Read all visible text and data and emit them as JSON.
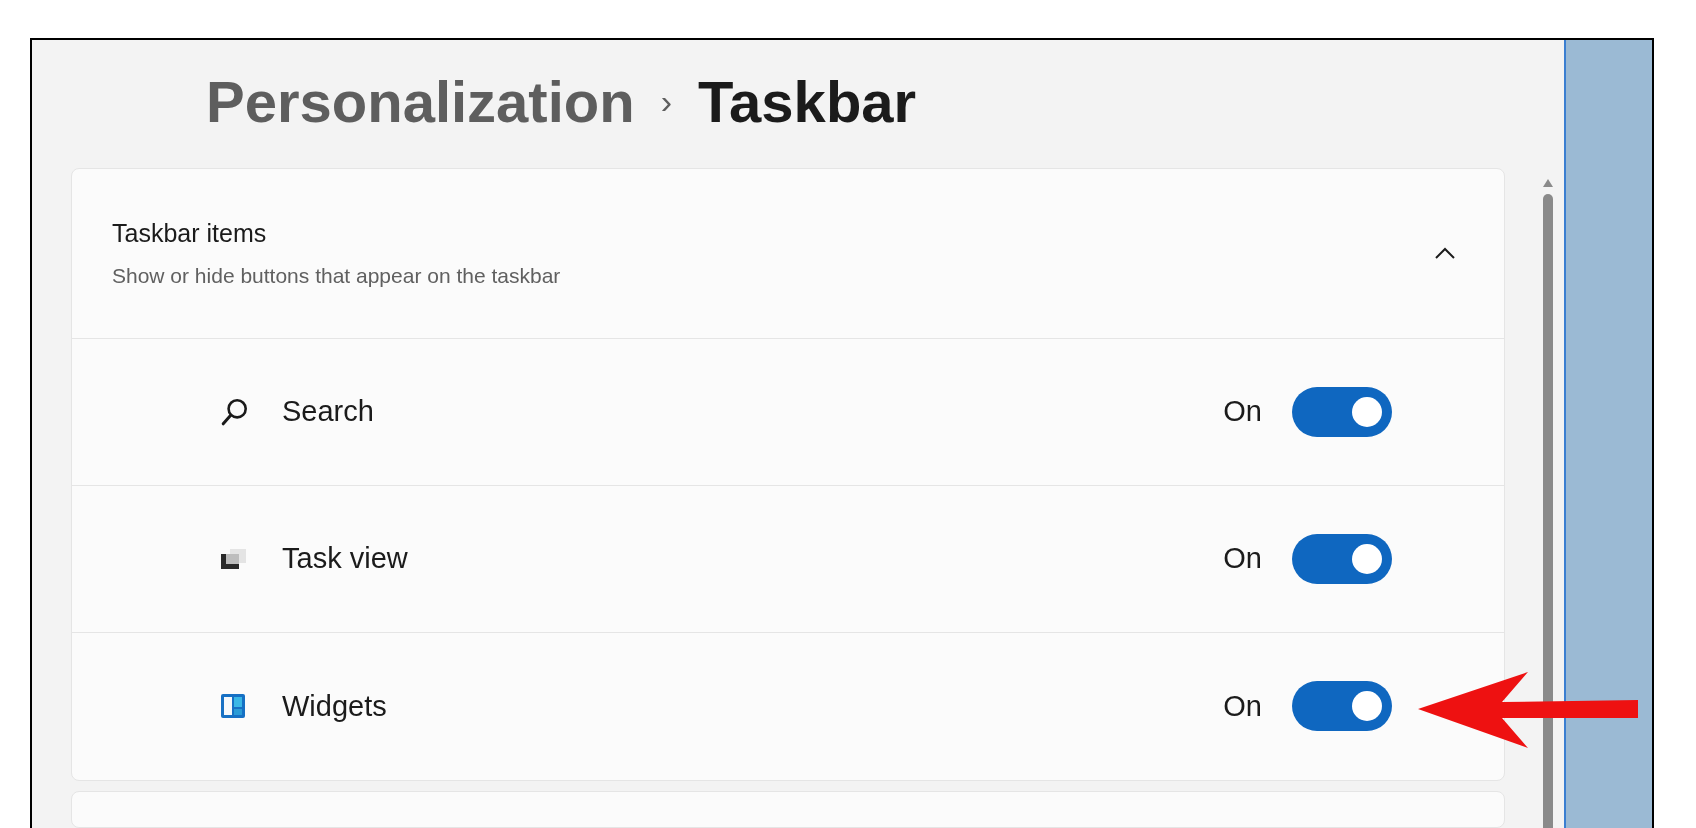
{
  "breadcrumb": {
    "parent": "Personalization",
    "separator": "›",
    "current": "Taskbar"
  },
  "section": {
    "title": "Taskbar items",
    "subtitle": "Show or hide buttons that appear on the taskbar",
    "expanded": true,
    "items": [
      {
        "kind": "search",
        "label": "Search",
        "state_text": "On",
        "on": true
      },
      {
        "kind": "taskview",
        "label": "Task view",
        "state_text": "On",
        "on": true
      },
      {
        "kind": "widgets",
        "label": "Widgets",
        "state_text": "On",
        "on": true
      }
    ]
  }
}
